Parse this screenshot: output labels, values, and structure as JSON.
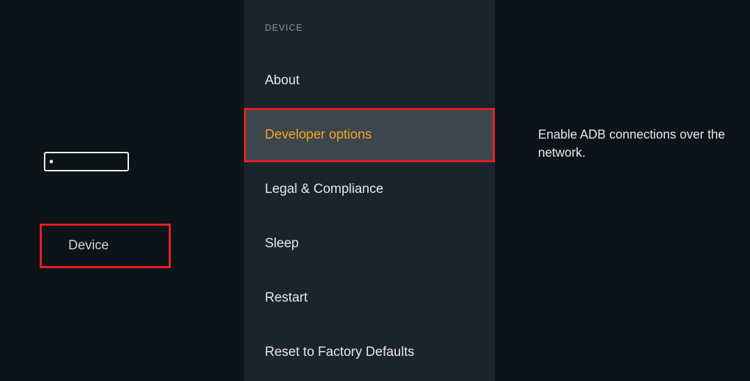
{
  "left": {
    "category_label": "Device"
  },
  "middle": {
    "section_heading": "DEVICE",
    "items": [
      {
        "label": "About",
        "selected": false
      },
      {
        "label": "Developer options",
        "selected": true
      },
      {
        "label": "Legal & Compliance",
        "selected": false
      },
      {
        "label": "Sleep",
        "selected": false
      },
      {
        "label": "Restart",
        "selected": false
      },
      {
        "label": "Reset to Factory Defaults",
        "selected": false
      }
    ]
  },
  "right": {
    "description": "Enable ADB connections over the network."
  },
  "annotation": {
    "highlight_color": "#ed1c24"
  }
}
